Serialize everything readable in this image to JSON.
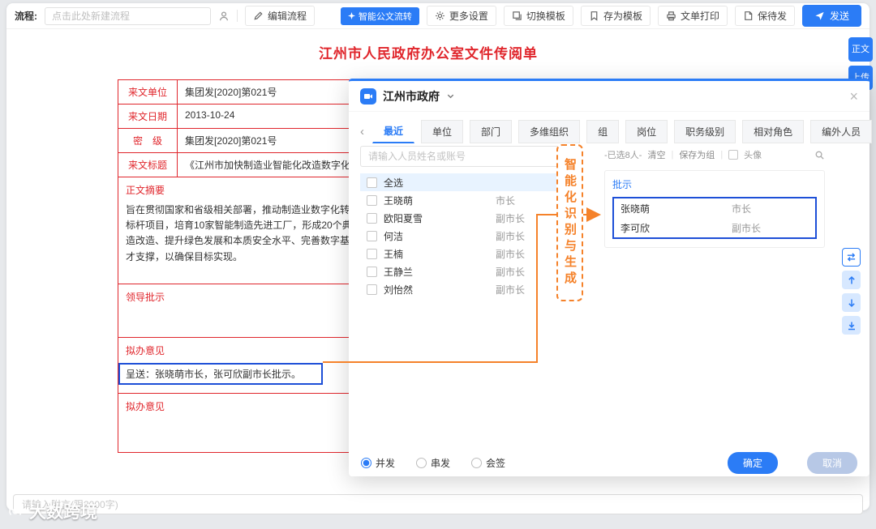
{
  "toolbar": {
    "flow_label": "流程:",
    "flow_placeholder": "点击此处新建流程",
    "edit_flow": "编辑流程",
    "smart_badge": "智能公文流转",
    "more_settings": "更多设置",
    "switch_template": "切换模板",
    "save_as_template": "存为模板",
    "print": "文单打印",
    "save_pending": "保待发",
    "send": "发送"
  },
  "side_buttons": {
    "main_text": "正文",
    "upload": "上传"
  },
  "document": {
    "title": "江州市人民政府办公室文件传阅单",
    "info_rows": [
      {
        "label": "来文单位",
        "value": "集团发[2020]第021号"
      },
      {
        "label": "来文日期",
        "value": "2013-10-24"
      },
      {
        "label": "密　级",
        "value": "集团发[2020]第021号"
      },
      {
        "label": "来文标题",
        "value": "《江州市加快制造业智能化改造数字化转型"
      }
    ],
    "sections": {
      "summary_label": "正文摘要",
      "summary_text": "旨在贯彻国家和省级相关部署，推动制造业数字化转型，提上标杆项目，培育10家智能制造先进工厂，形成20个典型应能制造改造、提升绿色发展和本质安全水平、完善数字基础导和人才支撑，以确保目标实现。",
      "leader_label": "领导批示",
      "opinion_label": "拟办意见",
      "opinion_text": "呈送：张晓萌市长，张可欣副市长批示。",
      "opinion2_label": "拟办意见"
    }
  },
  "annotation": {
    "text": "智能化识别与生成"
  },
  "modal": {
    "org_name": "江州市政府",
    "tabs": [
      {
        "label": "最近"
      },
      {
        "label": "单位"
      },
      {
        "label": "部门"
      },
      {
        "label": "多维组织"
      },
      {
        "label": "组"
      },
      {
        "label": "岗位"
      },
      {
        "label": "职务级别"
      },
      {
        "label": "相对角色"
      },
      {
        "label": "编外人员"
      }
    ],
    "search_placeholder": "请输入人员姓名或账号",
    "select_all_label": "全选",
    "people": [
      {
        "name": "王晓萌",
        "role": "市长"
      },
      {
        "name": "欧阳夏雪",
        "role": "副市长"
      },
      {
        "name": "何洁",
        "role": "副市长"
      },
      {
        "name": "王楠",
        "role": "副市长"
      },
      {
        "name": "王静兰",
        "role": "副市长"
      },
      {
        "name": "刘怡然",
        "role": "副市长"
      }
    ],
    "selected_count": "-已选8人-",
    "clear_label": "清空",
    "save_group_label": "保存为组",
    "avatar_label": "头像",
    "selected_header": "批示",
    "selected_people": [
      {
        "name": "张晓萌",
        "role": "市长"
      },
      {
        "name": "李可欣",
        "role": "副市长"
      }
    ],
    "send_modes": [
      {
        "label": "并发",
        "checked": true
      },
      {
        "label": "串发",
        "checked": false
      },
      {
        "label": "会签",
        "checked": false
      }
    ],
    "confirm": "确定",
    "cancel": "取消"
  },
  "footer": {
    "postscript_placeholder": "请输入附言(限2000字)"
  },
  "watermark": "大数跨境",
  "icons": {
    "chevron_left": "‹",
    "chevron_right": "›",
    "close": "×"
  },
  "colors": {
    "accent_blue": "#2b7cf6",
    "selection_blue": "#1d4fd7",
    "doc_red": "#e0262c",
    "annotation_orange": "#f5822a"
  }
}
